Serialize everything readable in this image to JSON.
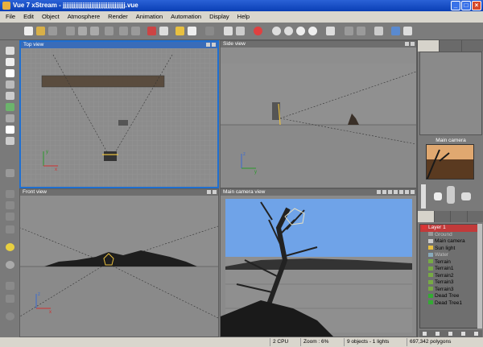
{
  "window": {
    "title": "Vue 7 xStream - jjjjjjjjjjjjjjjjjjjjjjjjjjjjjjjjjjj.vue",
    "min": "_",
    "max": "□",
    "close": "×"
  },
  "menu": [
    "File",
    "Edit",
    "Object",
    "Atmosphere",
    "Render",
    "Animation",
    "Automation",
    "Display",
    "Help"
  ],
  "viewports": {
    "top": "Top view",
    "side": "Side view",
    "front": "Front view",
    "camera": "Main camera view"
  },
  "axis": {
    "x": "x",
    "y": "y",
    "z": "z"
  },
  "right_panel": {
    "camera_label": "Main camera",
    "tree": [
      {
        "label": "Layer 1",
        "type": "layer"
      },
      {
        "label": "Ground",
        "type": "dim"
      },
      {
        "label": "Main camera",
        "type": "normal"
      },
      {
        "label": "Sun light",
        "type": "normal"
      },
      {
        "label": "Water",
        "type": "dim"
      },
      {
        "label": "Terrain",
        "type": "normal"
      },
      {
        "label": "Terrain1",
        "type": "normal"
      },
      {
        "label": "Terrain2",
        "type": "normal"
      },
      {
        "label": "Terrain3",
        "type": "normal"
      },
      {
        "label": "Terrain3",
        "type": "normal"
      },
      {
        "label": "Dead Tree",
        "type": "normal"
      },
      {
        "label": "Dead Tree1",
        "type": "normal"
      }
    ]
  },
  "status": {
    "cpu": "2 CPU",
    "zoom": "Zoom : 6%",
    "objects": "9 objects - 1 lights",
    "polygons": "697,342 polygons"
  },
  "colors": {
    "active_border": "#1f6fd0",
    "sky": "#6fa3e8",
    "layer_highlight": "#c23a3a"
  }
}
